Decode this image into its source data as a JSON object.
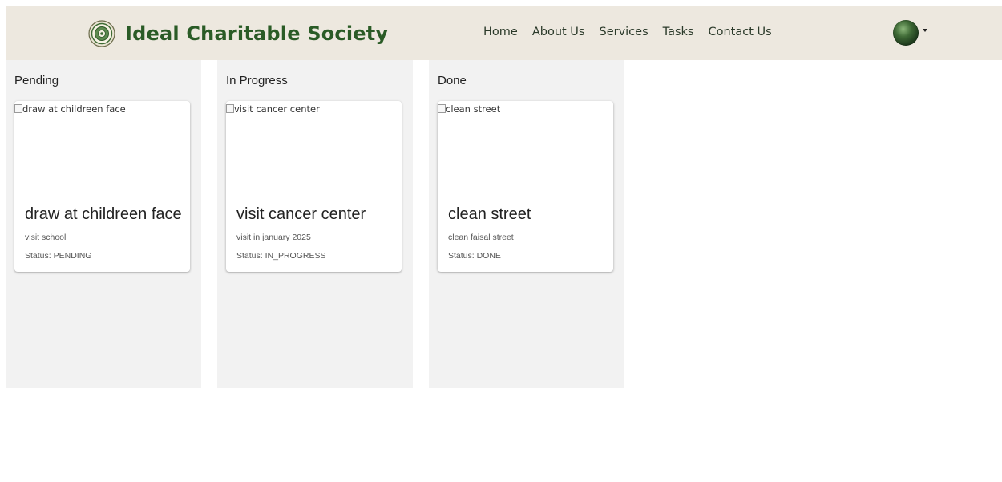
{
  "header": {
    "brand": "Ideal Charitable Society",
    "nav": [
      "Home",
      "About Us",
      "Services",
      "Tasks",
      "Contact Us"
    ]
  },
  "columns": [
    {
      "title": "Pending",
      "card": {
        "image_alt": "draw at childreen face",
        "title": "draw at childreen face",
        "description": "visit school",
        "status": "Status: PENDING"
      }
    },
    {
      "title": "In Progress",
      "card": {
        "image_alt": "visit cancer center",
        "title": "visit cancer center",
        "description": "visit in january 2025",
        "status": "Status: IN_PROGRESS"
      }
    },
    {
      "title": "Done",
      "card": {
        "image_alt": "clean street",
        "title": "clean street",
        "description": "clean faisal street",
        "status": "Status: DONE"
      }
    }
  ],
  "colors": {
    "navbar_bg": "#ede8df",
    "brand_text": "#2a5b26",
    "column_bg": "#f2f2f2",
    "card_bg": "#ffffff"
  }
}
